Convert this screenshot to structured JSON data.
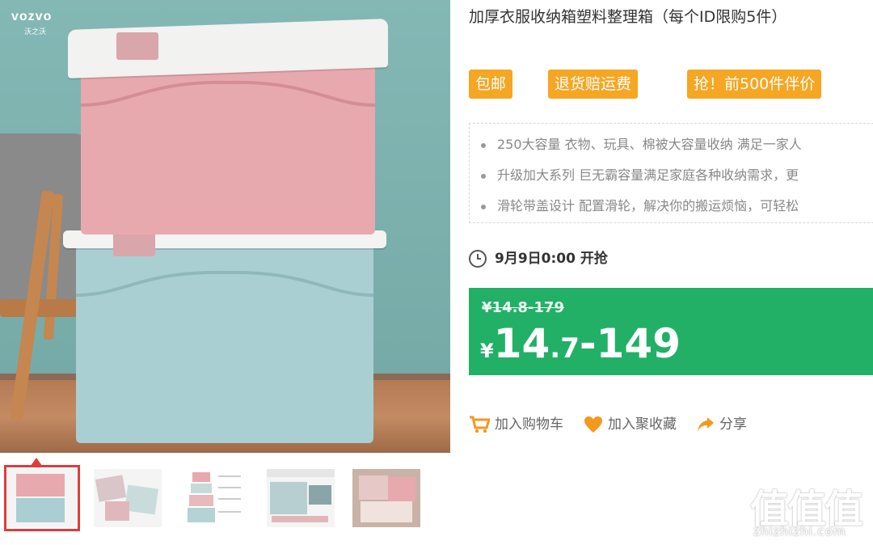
{
  "product": {
    "title": "加厚衣服收纳箱塑料整理箱（每个ID限购5件）",
    "brand_logo": "vozvo",
    "brand_logo_sub": "沃之沃",
    "tags": [
      "包邮",
      "退货赔运费",
      "抢！前500件伴价"
    ],
    "features": [
      "250大容量 衣物、玩具、棉被大容量收纳 满足一家人",
      "升级加大系列 巨无霸容量满足家庭各种收纳需求，更",
      "滑轮带盖设计 配置滑轮，解决你的搬运烦恼，可轻松"
    ],
    "sale_time": "9月9日0:00 开抢",
    "old_price": "¥14.8-179",
    "new_price": {
      "yen": "¥",
      "int": "14",
      "dec": ".7",
      "range": "-149"
    }
  },
  "actions": {
    "cart_label": "加入购物车",
    "fav_label": "加入聚收藏",
    "share_label": "分享"
  },
  "watermark": {
    "text": "值值值",
    "url": "zhizhizhi.com"
  },
  "colors": {
    "tag_orange": "#f5a623",
    "price_green": "#22b067",
    "action_orange": "#f29a1d",
    "active_thumb_border": "#e23a3a"
  }
}
